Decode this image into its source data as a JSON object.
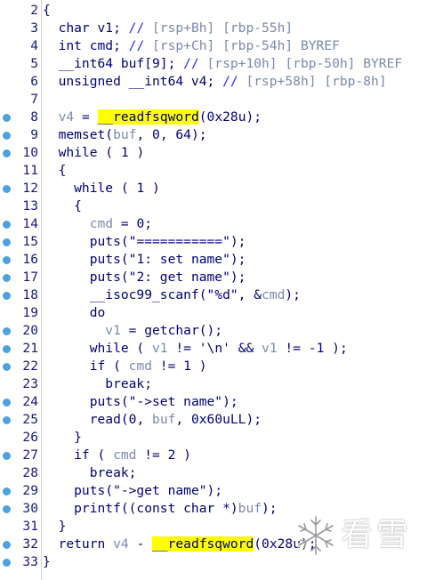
{
  "watermark": {
    "text": "看雪"
  },
  "colors": {
    "breakpoint": "#4aa3df",
    "line_number": "#1a1a7e",
    "code": "#00007e",
    "variable": "#7b88b3",
    "comment_blue": "#2929ff",
    "highlight": "#ffff00"
  },
  "lines": [
    {
      "num": "2",
      "bp": false,
      "tokens": [
        {
          "t": "{",
          "c": "kw"
        }
      ]
    },
    {
      "num": "3",
      "bp": false,
      "tokens": [
        {
          "t": "  char v1; ",
          "c": "kw"
        },
        {
          "t": "// ",
          "c": "com"
        },
        {
          "t": "[rsp+Bh] [rbp-55h]",
          "c": "cmt"
        }
      ]
    },
    {
      "num": "4",
      "bp": false,
      "tokens": [
        {
          "t": "  int cmd; ",
          "c": "kw"
        },
        {
          "t": "// ",
          "c": "com"
        },
        {
          "t": "[rsp+Ch] [rbp-54h] BYREF",
          "c": "cmt"
        }
      ]
    },
    {
      "num": "5",
      "bp": false,
      "tokens": [
        {
          "t": "  __int64 buf[9]; ",
          "c": "kw"
        },
        {
          "t": "// ",
          "c": "com"
        },
        {
          "t": "[rsp+10h] [rbp-50h] BYREF",
          "c": "cmt"
        }
      ]
    },
    {
      "num": "6",
      "bp": false,
      "tokens": [
        {
          "t": "  unsigned __int64 v4; ",
          "c": "kw"
        },
        {
          "t": "// ",
          "c": "com"
        },
        {
          "t": "[rsp+58h] [rbp-8h]",
          "c": "cmt"
        }
      ]
    },
    {
      "num": "7",
      "bp": false,
      "tokens": []
    },
    {
      "num": "8",
      "bp": true,
      "tokens": [
        {
          "t": "  ",
          "c": "kw"
        },
        {
          "t": "v4",
          "c": "var"
        },
        {
          "t": " = ",
          "c": "kw"
        },
        {
          "t": "__readfs",
          "c": "hl"
        },
        {
          "t": "",
          "c": "caret"
        },
        {
          "t": "qword",
          "c": "hl"
        },
        {
          "t": "(",
          "c": "kw"
        },
        {
          "t": "0x28u",
          "c": "num"
        },
        {
          "t": ");",
          "c": "kw"
        }
      ]
    },
    {
      "num": "9",
      "bp": true,
      "tokens": [
        {
          "t": "  memset(",
          "c": "kw"
        },
        {
          "t": "buf",
          "c": "var"
        },
        {
          "t": ", ",
          "c": "kw"
        },
        {
          "t": "0",
          "c": "num"
        },
        {
          "t": ", ",
          "c": "kw"
        },
        {
          "t": "64",
          "c": "num"
        },
        {
          "t": ");",
          "c": "kw"
        }
      ]
    },
    {
      "num": "10",
      "bp": true,
      "tokens": [
        {
          "t": "  while ( ",
          "c": "kw"
        },
        {
          "t": "1",
          "c": "num"
        },
        {
          "t": " )",
          "c": "kw"
        }
      ]
    },
    {
      "num": "11",
      "bp": false,
      "tokens": [
        {
          "t": "  {",
          "c": "kw"
        }
      ]
    },
    {
      "num": "12",
      "bp": true,
      "tokens": [
        {
          "t": "    while ( ",
          "c": "kw"
        },
        {
          "t": "1",
          "c": "num"
        },
        {
          "t": " )",
          "c": "kw"
        }
      ]
    },
    {
      "num": "13",
      "bp": false,
      "tokens": [
        {
          "t": "    {",
          "c": "kw"
        }
      ]
    },
    {
      "num": "14",
      "bp": true,
      "tokens": [
        {
          "t": "      ",
          "c": "kw"
        },
        {
          "t": "cmd",
          "c": "var"
        },
        {
          "t": " = ",
          "c": "kw"
        },
        {
          "t": "0",
          "c": "num"
        },
        {
          "t": ";",
          "c": "kw"
        }
      ]
    },
    {
      "num": "15",
      "bp": true,
      "tokens": [
        {
          "t": "      puts(",
          "c": "kw"
        },
        {
          "t": "\"===========\"",
          "c": "str"
        },
        {
          "t": ");",
          "c": "kw"
        }
      ]
    },
    {
      "num": "16",
      "bp": true,
      "tokens": [
        {
          "t": "      puts(",
          "c": "kw"
        },
        {
          "t": "\"1: set name\"",
          "c": "str"
        },
        {
          "t": ");",
          "c": "kw"
        }
      ]
    },
    {
      "num": "17",
      "bp": true,
      "tokens": [
        {
          "t": "      puts(",
          "c": "kw"
        },
        {
          "t": "\"2: get name\"",
          "c": "str"
        },
        {
          "t": ");",
          "c": "kw"
        }
      ]
    },
    {
      "num": "18",
      "bp": true,
      "tokens": [
        {
          "t": "      __isoc99_scanf(",
          "c": "kw"
        },
        {
          "t": "\"%d\"",
          "c": "str"
        },
        {
          "t": ", &",
          "c": "kw"
        },
        {
          "t": "cmd",
          "c": "var"
        },
        {
          "t": ");",
          "c": "kw"
        }
      ]
    },
    {
      "num": "19",
      "bp": false,
      "tokens": [
        {
          "t": "      do",
          "c": "kw"
        }
      ]
    },
    {
      "num": "20",
      "bp": true,
      "tokens": [
        {
          "t": "        ",
          "c": "kw"
        },
        {
          "t": "v1",
          "c": "var"
        },
        {
          "t": " = getchar();",
          "c": "kw"
        }
      ]
    },
    {
      "num": "21",
      "bp": true,
      "tokens": [
        {
          "t": "      while ( ",
          "c": "kw"
        },
        {
          "t": "v1",
          "c": "var"
        },
        {
          "t": " != ",
          "c": "kw"
        },
        {
          "t": "'\\n'",
          "c": "str"
        },
        {
          "t": " && ",
          "c": "kw"
        },
        {
          "t": "v1",
          "c": "var"
        },
        {
          "t": " != ",
          "c": "kw"
        },
        {
          "t": "-1",
          "c": "num"
        },
        {
          "t": " );",
          "c": "kw"
        }
      ]
    },
    {
      "num": "22",
      "bp": true,
      "tokens": [
        {
          "t": "      if ( ",
          "c": "kw"
        },
        {
          "t": "cmd",
          "c": "var"
        },
        {
          "t": " != ",
          "c": "kw"
        },
        {
          "t": "1",
          "c": "num"
        },
        {
          "t": " )",
          "c": "kw"
        }
      ]
    },
    {
      "num": "23",
      "bp": false,
      "tokens": [
        {
          "t": "        break;",
          "c": "kw"
        }
      ]
    },
    {
      "num": "24",
      "bp": true,
      "tokens": [
        {
          "t": "      puts(",
          "c": "kw"
        },
        {
          "t": "\"->set name\"",
          "c": "str"
        },
        {
          "t": ");",
          "c": "kw"
        }
      ]
    },
    {
      "num": "25",
      "bp": true,
      "tokens": [
        {
          "t": "      read(",
          "c": "kw"
        },
        {
          "t": "0",
          "c": "num"
        },
        {
          "t": ", ",
          "c": "kw"
        },
        {
          "t": "buf",
          "c": "var"
        },
        {
          "t": ", ",
          "c": "kw"
        },
        {
          "t": "0x60uLL",
          "c": "num"
        },
        {
          "t": ");",
          "c": "kw"
        }
      ]
    },
    {
      "num": "26",
      "bp": false,
      "tokens": [
        {
          "t": "    }",
          "c": "kw"
        }
      ]
    },
    {
      "num": "27",
      "bp": true,
      "tokens": [
        {
          "t": "    if ( ",
          "c": "kw"
        },
        {
          "t": "cmd",
          "c": "var"
        },
        {
          "t": " != ",
          "c": "kw"
        },
        {
          "t": "2",
          "c": "num"
        },
        {
          "t": " )",
          "c": "kw"
        }
      ]
    },
    {
      "num": "28",
      "bp": false,
      "tokens": [
        {
          "t": "      break;",
          "c": "kw"
        }
      ]
    },
    {
      "num": "29",
      "bp": true,
      "tokens": [
        {
          "t": "    puts(",
          "c": "kw"
        },
        {
          "t": "\"->get name\"",
          "c": "str"
        },
        {
          "t": ");",
          "c": "kw"
        }
      ]
    },
    {
      "num": "30",
      "bp": true,
      "tokens": [
        {
          "t": "    printf((const char *)",
          "c": "kw"
        },
        {
          "t": "buf",
          "c": "var"
        },
        {
          "t": ");",
          "c": "kw"
        }
      ]
    },
    {
      "num": "31",
      "bp": false,
      "tokens": [
        {
          "t": "  }",
          "c": "kw"
        }
      ]
    },
    {
      "num": "32",
      "bp": true,
      "tokens": [
        {
          "t": "  return ",
          "c": "kw"
        },
        {
          "t": "v4",
          "c": "var"
        },
        {
          "t": " - ",
          "c": "kw"
        },
        {
          "t": "__readfsqword",
          "c": "hl"
        },
        {
          "t": "(",
          "c": "kw"
        },
        {
          "t": "0x28u",
          "c": "num"
        },
        {
          "t": ");",
          "c": "kw"
        }
      ]
    },
    {
      "num": "33",
      "bp": true,
      "tokens": [
        {
          "t": "}",
          "c": "kw"
        }
      ]
    }
  ]
}
